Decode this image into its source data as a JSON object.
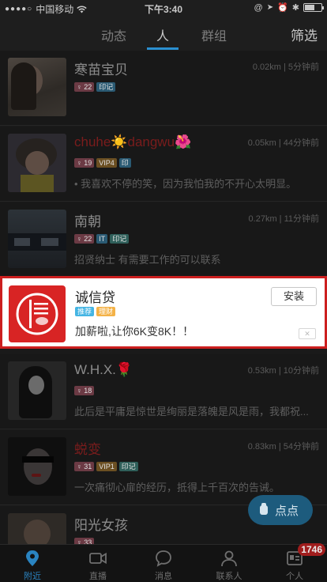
{
  "status_bar": {
    "carrier": "中国移动",
    "time": "下午3:40"
  },
  "nav": {
    "tabs": [
      "动态",
      "人",
      "群组"
    ],
    "active_index": 1,
    "filter": "筛选"
  },
  "users": [
    {
      "name": "寒苗宝贝",
      "distance_time": "0.02km | 5分钟前",
      "badges": [
        "22",
        "印记"
      ],
      "signature": ""
    },
    {
      "name": "chuhe☀️dangwu🌺",
      "distance_time": "0.05km | 44分钟前",
      "badges": [
        "19",
        "VIP4",
        "印"
      ],
      "signature": "•      我喜欢不停的笑，因为我怕我的不开心太明显。"
    },
    {
      "name": "南朝",
      "distance_time": "0.27km | 11分钟前",
      "badges": [
        "22",
        "IT",
        "印记"
      ],
      "signature": "招贤纳士 有需要工作的可以联系"
    },
    {
      "name": "W.H.X.🌹",
      "distance_time": "0.53km | 10分钟前",
      "badges": [
        "18"
      ],
      "signature": "此后是平庸是惊世是绚丽是落魄是风是雨，我都祝..."
    },
    {
      "name": "蜕变",
      "distance_time": "0.83km | 54分钟前",
      "badges": [
        "31",
        "VIP1",
        "印记"
      ],
      "signature": "一次痛彻心扉的经历，抵得上千百次的告诫。"
    },
    {
      "name": "阳光女孩",
      "distance_time": "",
      "badges": [
        "33"
      ],
      "signature": ""
    }
  ],
  "ad": {
    "name": "诚信贷",
    "tags": [
      "推荐",
      "理财"
    ],
    "description": "加薪啦,让你6K变8K！！",
    "install_label": "安装",
    "close_label": "✕"
  },
  "fab": {
    "label": "点点"
  },
  "tabbar": {
    "items": [
      "附近",
      "直播",
      "消息",
      "联系人",
      "个人"
    ],
    "active_index": 0,
    "badge_count": "1746"
  }
}
